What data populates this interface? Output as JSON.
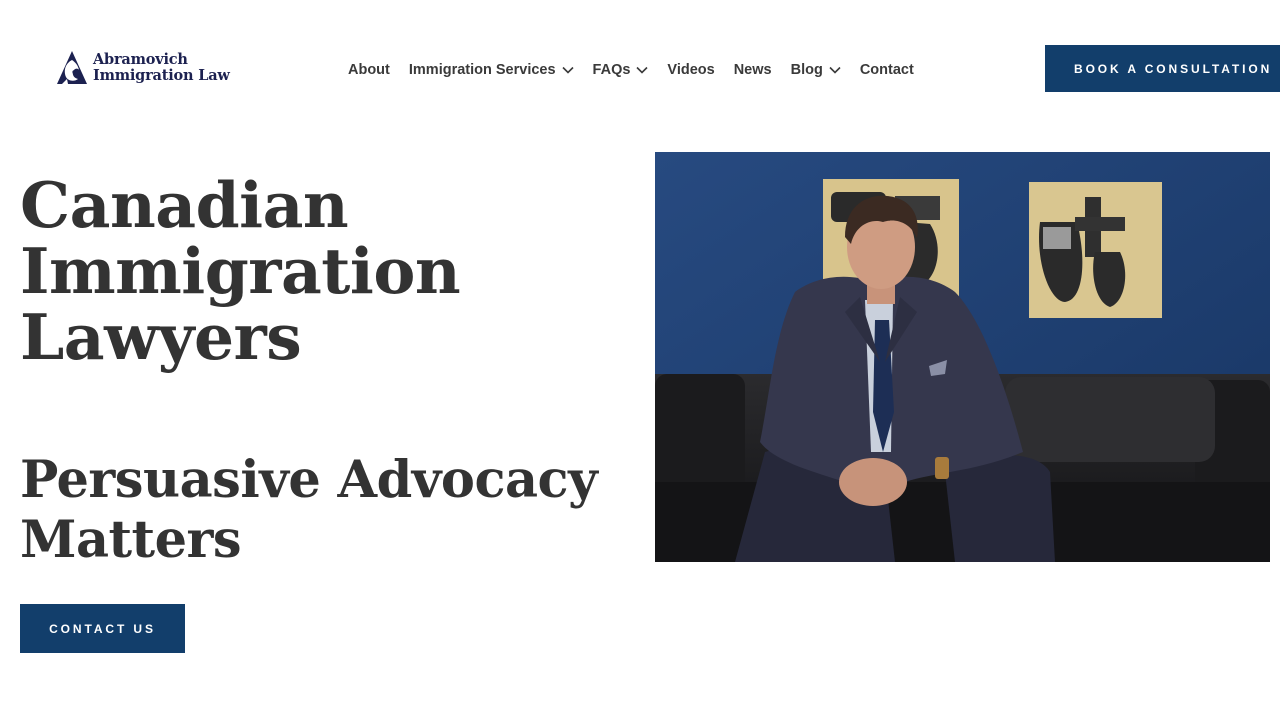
{
  "header": {
    "logo": {
      "line1": "Abramovich",
      "line2": "Immigration Law",
      "icon": "lion-shield-icon"
    },
    "nav": [
      {
        "label": "About",
        "has_dropdown": false
      },
      {
        "label": "Immigration Services",
        "has_dropdown": true
      },
      {
        "label": "FAQs",
        "has_dropdown": true
      },
      {
        "label": "Videos",
        "has_dropdown": false
      },
      {
        "label": "News",
        "has_dropdown": false
      },
      {
        "label": "Blog",
        "has_dropdown": true
      },
      {
        "label": "Contact",
        "has_dropdown": false
      }
    ],
    "cta_label": "BOOK A CONSULTATION"
  },
  "hero": {
    "title_lines": [
      "Canadian",
      "Immigration",
      "Lawyers"
    ],
    "subtitle_lines": [
      "Persuasive Advocacy",
      "Matters"
    ],
    "cta_label": "CONTACT US",
    "photo": "lawyer-portrait-image"
  },
  "colors": {
    "brand_navy": "#123e6b",
    "logo_navy": "#1c2150",
    "text_dark": "#333333",
    "wall_blue": "#1f3f73"
  }
}
